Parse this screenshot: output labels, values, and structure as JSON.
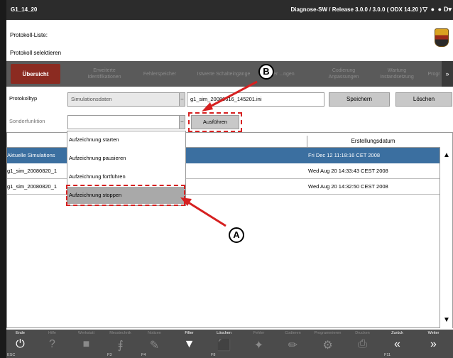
{
  "titlebar": {
    "title": "G1_14_20",
    "info": "Diagnose-SW / Release 3.0.0 / 3.0.0  ( ODX   14.20 )",
    "icons": [
      "funnel-icon",
      "dot-icon",
      "dot-icon",
      "d-menu-icon"
    ],
    "icon_glyphs": [
      "▽",
      "●",
      "●",
      "D▾"
    ]
  },
  "header": {
    "line1": "Protokoll-Liste:",
    "line2": "Protokoll selektieren"
  },
  "tabs": [
    {
      "label": "Übersicht",
      "active": true
    },
    {
      "label": "Erweiterte Identifikationen",
      "active": false
    },
    {
      "label": "Fehlerspeicher",
      "active": false
    },
    {
      "label": "Istwerte Schalteingänge",
      "active": false
    },
    {
      "label": "...der ...ngen",
      "active": false
    },
    {
      "label": "Codierung Anpassungen",
      "active": false
    },
    {
      "label": "Wartung Instandsetzung",
      "active": false
    },
    {
      "label": "Progr",
      "active": false
    }
  ],
  "tab_next": "»",
  "form": {
    "protokolltyp_label": "Protokolltyp",
    "protokolltyp_value": "Simulationsdaten",
    "filename_value": "g1_sim_20080616_145201.ini",
    "speichern_label": "Speichern",
    "loeschen_label": "Löschen",
    "sonderfunktion_label": "Sonderfunktion",
    "sonderfunktion_value": "",
    "ausfuehren_label": "Ausführen",
    "arrow_glyph": "–"
  },
  "table": {
    "headers": [
      "",
      "Erstellungsdatum"
    ],
    "rows": [
      {
        "name": "Aktuelle Simulations",
        "date": "Fri Dec 12 11:18:16 CET 2008",
        "selected": true
      },
      {
        "name": "g1_sim_20080820_1",
        "date": "Wed Aug 20 14:33:43 CEST 2008",
        "selected": false
      },
      {
        "name": "g1_sim_20080820_1",
        "date": "Wed Aug 20 14:32:50 CEST 2008",
        "selected": false
      }
    ],
    "scroll_up": "▲",
    "scroll_down": "▼"
  },
  "dropdown": {
    "items": [
      {
        "label": "Aufzeichnung starten",
        "hot": false
      },
      {
        "label": "Aufzeichnung pausieren",
        "hot": false
      },
      {
        "label": "Aufzeichnung fortführen",
        "hot": false
      },
      {
        "label": "Aufzeichnung stoppen",
        "hot": true
      }
    ]
  },
  "callouts": {
    "a": "A",
    "b": "B"
  },
  "statusbar": {
    "keys": [
      {
        "label": "Ende",
        "icon": "⏻",
        "code": "ESC",
        "on": true,
        "icon_name": "power-icon"
      },
      {
        "label": "Hilfe",
        "icon": "?",
        "code": "",
        "on": false,
        "icon_name": "help-icon"
      },
      {
        "label": "Werkstatt",
        "icon": "■",
        "code": "",
        "on": false,
        "icon_name": "workshop-icon"
      },
      {
        "label": "Messtechnik",
        "icon": "⨎",
        "code": "F3",
        "on": false,
        "icon_name": "measure-icon"
      },
      {
        "label": "Notizen",
        "icon": "✎",
        "code": "F4",
        "on": false,
        "icon_name": "note-icon"
      },
      {
        "label": "Filter",
        "icon": "▼",
        "code": "",
        "on": true,
        "icon_name": "filter-icon"
      },
      {
        "label": "Löschen",
        "icon": "⬛",
        "code": "F8",
        "on": true,
        "icon_name": "delete-icon"
      },
      {
        "label": "Fehler",
        "icon": "✦",
        "code": "",
        "on": false,
        "icon_name": "error-icon"
      },
      {
        "label": "Codieren",
        "icon": "✏",
        "code": "",
        "on": false,
        "icon_name": "code-icon"
      },
      {
        "label": "Programmieren",
        "icon": "⚙",
        "code": "",
        "on": false,
        "icon_name": "program-icon"
      },
      {
        "label": "Drucken",
        "icon": "⎙",
        "code": "",
        "on": false,
        "icon_name": "print-icon"
      },
      {
        "label": "Zurück",
        "icon": "«",
        "code": "F11",
        "on": true,
        "icon_name": "back-icon"
      },
      {
        "label": "Weiter",
        "icon": "»",
        "code": "",
        "on": true,
        "icon_name": "forward-icon"
      }
    ]
  }
}
